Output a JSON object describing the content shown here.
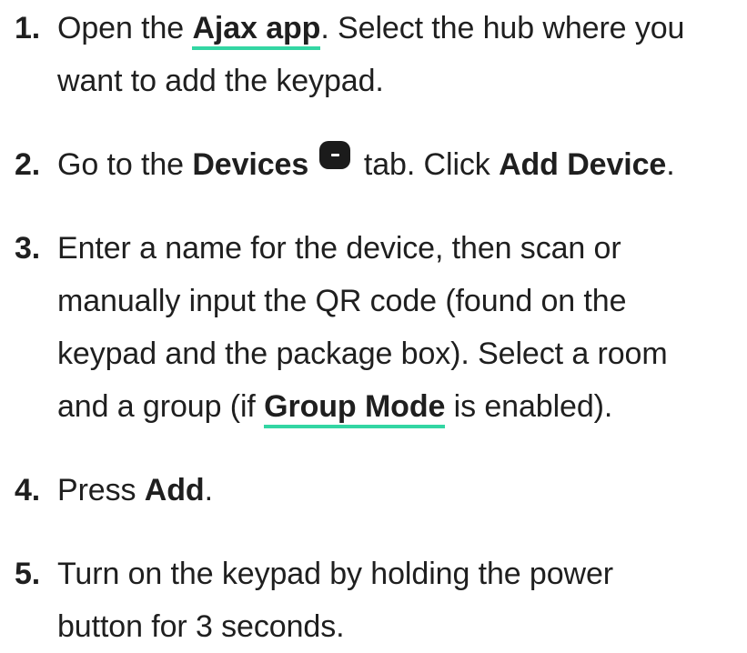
{
  "steps": [
    {
      "number": "1.",
      "line1_pre": "Open the ",
      "link": "Ajax app",
      "line1_post": ". Select the hub where you",
      "line2": "want to add the keypad."
    },
    {
      "number": "2.",
      "pre": "Go to the ",
      "bold1": "Devices",
      "icon": "devices-tab-icon",
      "mid": " tab. Click ",
      "bold2": "Add Device",
      "post": "."
    },
    {
      "number": "3.",
      "line1": "Enter a name for the device, then scan or",
      "line2": "manually input the QR code (found on the",
      "line3": "keypad and the package box). Select a room",
      "line4_pre": "and a group (if ",
      "link": "Group Mode",
      "line4_post": " is enabled)."
    },
    {
      "number": "4.",
      "pre": "Press ",
      "bold": "Add",
      "post": "."
    },
    {
      "number": "5.",
      "line1": "Turn on the keypad by holding the power",
      "line2": "button for 3 seconds."
    }
  ],
  "colors": {
    "text": "#1f1f1f",
    "link_underline": "#33d6a3",
    "icon_bg": "#1b1b1b"
  }
}
